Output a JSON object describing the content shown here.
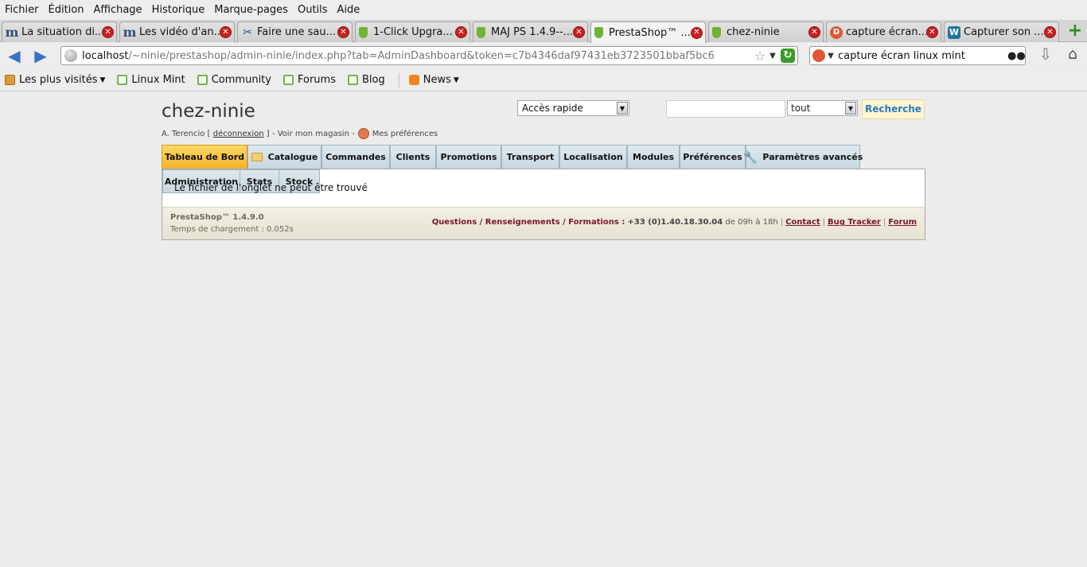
{
  "menu": [
    "Fichier",
    "Édition",
    "Affichage",
    "Historique",
    "Marque-pages",
    "Outils",
    "Aide"
  ],
  "tabs": [
    {
      "label": "La situation di...",
      "icon": "mint-m"
    },
    {
      "label": "Les vidéo d'an...",
      "icon": "mint-m"
    },
    {
      "label": "Faire une sau...",
      "icon": "tools"
    },
    {
      "label": "1-Click Upgra...",
      "icon": "presta"
    },
    {
      "label": "MAJ PS 1.4.9--...",
      "icon": "presta"
    },
    {
      "label": "PrestaShop™ ...",
      "icon": "presta"
    },
    {
      "label": "chez-ninie",
      "icon": "presta"
    },
    {
      "label": "capture écran...",
      "icon": "ddg"
    },
    {
      "label": "Capturer son ...",
      "icon": "wp"
    }
  ],
  "active_tab_index": 5,
  "url": {
    "host": "localhost",
    "path": "/~ninie/prestashop/admin-ninie/index.php?tab=AdminDashboard&token=c7b4346daf97431eb3723501bbaf5bc6"
  },
  "search_bar": {
    "value": "capture écran linux mint"
  },
  "bookmarks": [
    {
      "label": "Les plus visités",
      "icon": "folder",
      "dropdown": true
    },
    {
      "label": "Linux Mint",
      "icon": "mint",
      "dropdown": false
    },
    {
      "label": "Community",
      "icon": "mint",
      "dropdown": false
    },
    {
      "label": "Forums",
      "icon": "mint",
      "dropdown": false
    },
    {
      "label": "Blog",
      "icon": "mint",
      "dropdown": false
    },
    {
      "label": "News",
      "icon": "rss",
      "dropdown": true
    }
  ],
  "page": {
    "shop_name": "chez-ninie",
    "user": {
      "name": "A. Terencio [",
      "logout": "déconnexion",
      "after_logout": "] - Voir mon magasin -",
      "preferences": "Mes préférences"
    },
    "quick_access": "Accès rapide",
    "search": {
      "value": "",
      "scope": "tout",
      "button": "Recherche"
    },
    "main_tabs": [
      "Tableau de Bord",
      "Catalogue",
      "Commandes",
      "Clients",
      "Promotions",
      "Transport",
      "Localisation",
      "Modules",
      "Préférences",
      "Paramètres avancés"
    ],
    "sub_tabs": [
      "Administration",
      "Stats",
      "Stock"
    ],
    "error": "Le fichier de l'onglet ne peut être trouvé",
    "footer": {
      "version": "PrestaShop™ 1.4.9.0",
      "load_time": "Temps de chargement : 0.052s",
      "links_label": "Questions / Renseignements / Formations :",
      "phone": "+33 (0)1.40.18.30.04",
      "hours": "de 09h à 18h",
      "contact": "Contact",
      "bugtracker": "Bug Tracker",
      "forum": "Forum"
    }
  }
}
